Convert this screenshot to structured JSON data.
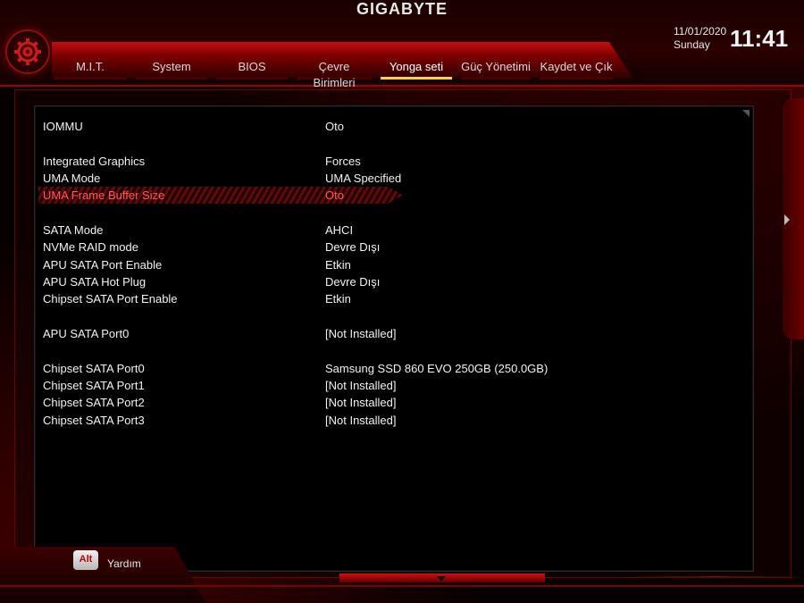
{
  "header": {
    "brand": "GIGABYTE",
    "date": "11/01/2020",
    "day": "Sunday",
    "time": "11:41"
  },
  "tabs": [
    {
      "label": "M.I.T.",
      "active": false
    },
    {
      "label": "System",
      "active": false
    },
    {
      "label": "BIOS",
      "active": false
    },
    {
      "label": "Çevre Birimleri",
      "active": false
    },
    {
      "label": "Yonga seti",
      "active": true
    },
    {
      "label": "Güç Yönetimi",
      "active": false
    },
    {
      "label": "Kaydet ve Çık",
      "active": false
    }
  ],
  "settings": [
    {
      "label": "IOMMU",
      "value": "Oto"
    },
    {
      "label": "Integrated Graphics",
      "value": "Forces"
    },
    {
      "label": "UMA Mode",
      "value": "UMA Specified"
    },
    {
      "label": "UMA Frame Buffer Size",
      "value": "Oto",
      "selected": true
    },
    {
      "label": "SATA Mode",
      "value": "AHCI"
    },
    {
      "label": "NVMe RAID mode",
      "value": "Devre Dışı"
    },
    {
      "label": "APU SATA Port Enable",
      "value": "Etkin"
    },
    {
      "label": "APU SATA Hot Plug",
      "value": "Devre Dışı"
    },
    {
      "label": "Chipset SATA Port Enable",
      "value": "Etkin"
    },
    {
      "label": "APU SATA Port0",
      "value": "[Not Installed]"
    },
    {
      "label": "Chipset SATA Port0",
      "value": "Samsung SSD 860 EVO 250GB (250.0GB)"
    },
    {
      "label": "Chipset SATA Port1",
      "value": "[Not Installed]"
    },
    {
      "label": "Chipset SATA Port2",
      "value": "[Not Installed]"
    },
    {
      "label": "Chipset SATA Port3",
      "value": "[Not Installed]"
    }
  ],
  "footer": {
    "alt_key": "Alt",
    "help_label": "Yardım"
  },
  "colors": {
    "accent": "#c41010",
    "selected_text": "#ff5a5a",
    "active_tab_underline": "#ffcf40"
  }
}
